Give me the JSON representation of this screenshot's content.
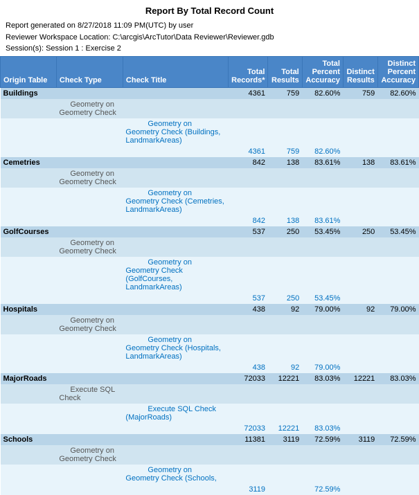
{
  "report": {
    "title": "Report By Total Record Count",
    "meta": {
      "line1": "Report generated on 8/27/2018 11:09 PM(UTC) by user",
      "line2": "Reviewer Workspace Location: C:\\arcgis\\ArcTutor\\Data Reviewer\\Reviewer.gdb",
      "line3": "Session(s): Session 1 : Exercise 2"
    },
    "columns": {
      "origin": "Origin Table",
      "checkType": "Check Type",
      "checkTitle": "Check Title",
      "totalRecords": "Total Records*",
      "totalResults": "Total Results",
      "totalPctAccuracy": "Total Percent Accuracy",
      "distinctResults": "Distinct Results",
      "distinctPctAccuracy": "Distinct Percent Accuracy"
    },
    "rows": [
      {
        "type": "origin",
        "origin": "Buildings",
        "totalRecords": "4361",
        "totalResults": "759",
        "totalPctAccuracy": "82.60%",
        "distinctResults": "759",
        "distinctPctAccuracy": "82.60%"
      },
      {
        "type": "checktype",
        "checkType": "Geometry on Geometry Check"
      },
      {
        "type": "detail",
        "checkTitle": "Geometry on Geometry Check (Buildings, LandmarkAreas)"
      },
      {
        "type": "summary",
        "totalRecords": "4361",
        "totalResults": "759",
        "totalPctAccuracy": "82.60%"
      },
      {
        "type": "origin",
        "origin": "Cemetries",
        "totalRecords": "842",
        "totalResults": "138",
        "totalPctAccuracy": "83.61%",
        "distinctResults": "138",
        "distinctPctAccuracy": "83.61%"
      },
      {
        "type": "checktype",
        "checkType": "Geometry on Geometry Check"
      },
      {
        "type": "detail",
        "checkTitle": "Geometry on Geometry Check (Cemetries, LandmarkAreas)"
      },
      {
        "type": "summary",
        "totalRecords": "842",
        "totalResults": "138",
        "totalPctAccuracy": "83.61%"
      },
      {
        "type": "origin",
        "origin": "GolfCourses",
        "totalRecords": "537",
        "totalResults": "250",
        "totalPctAccuracy": "53.45%",
        "distinctResults": "250",
        "distinctPctAccuracy": "53.45%"
      },
      {
        "type": "checktype",
        "checkType": "Geometry on Geometry Check"
      },
      {
        "type": "detail",
        "checkTitle": "Geometry on Geometry Check (GolfCourses, LandmarkAreas)"
      },
      {
        "type": "summary",
        "totalRecords": "537",
        "totalResults": "250",
        "totalPctAccuracy": "53.45%"
      },
      {
        "type": "origin",
        "origin": "Hospitals",
        "totalRecords": "438",
        "totalResults": "92",
        "totalPctAccuracy": "79.00%",
        "distinctResults": "92",
        "distinctPctAccuracy": "79.00%"
      },
      {
        "type": "checktype",
        "checkType": "Geometry on Geometry Check"
      },
      {
        "type": "detail",
        "checkTitle": "Geometry on Geometry Check (Hospitals, LandmarkAreas)"
      },
      {
        "type": "summary",
        "totalRecords": "438",
        "totalResults": "92",
        "totalPctAccuracy": "79.00%"
      },
      {
        "type": "origin",
        "origin": "MajorRoads",
        "totalRecords": "72033",
        "totalResults": "12221",
        "totalPctAccuracy": "83.03%",
        "distinctResults": "12221",
        "distinctPctAccuracy": "83.03%"
      },
      {
        "type": "checktype",
        "checkType": "Execute SQL Check"
      },
      {
        "type": "detail",
        "checkTitle": "Execute SQL Check (MajorRoads)"
      },
      {
        "type": "summary",
        "totalRecords": "72033",
        "totalResults": "12221",
        "totalPctAccuracy": "83.03%"
      },
      {
        "type": "origin",
        "origin": "Schools",
        "totalRecords": "11381",
        "totalResults": "3119",
        "totalPctAccuracy": "72.59%",
        "distinctResults": "3119",
        "distinctPctAccuracy": "72.59%"
      },
      {
        "type": "checktype",
        "checkType": "Geometry on Geometry Check"
      },
      {
        "type": "detail",
        "checkTitle": "Geometry on Geometry Check (Schools,"
      },
      {
        "type": "summary",
        "totalRecords": "3119",
        "totalResults": "",
        "totalPctAccuracy": "72.59%"
      }
    ]
  }
}
